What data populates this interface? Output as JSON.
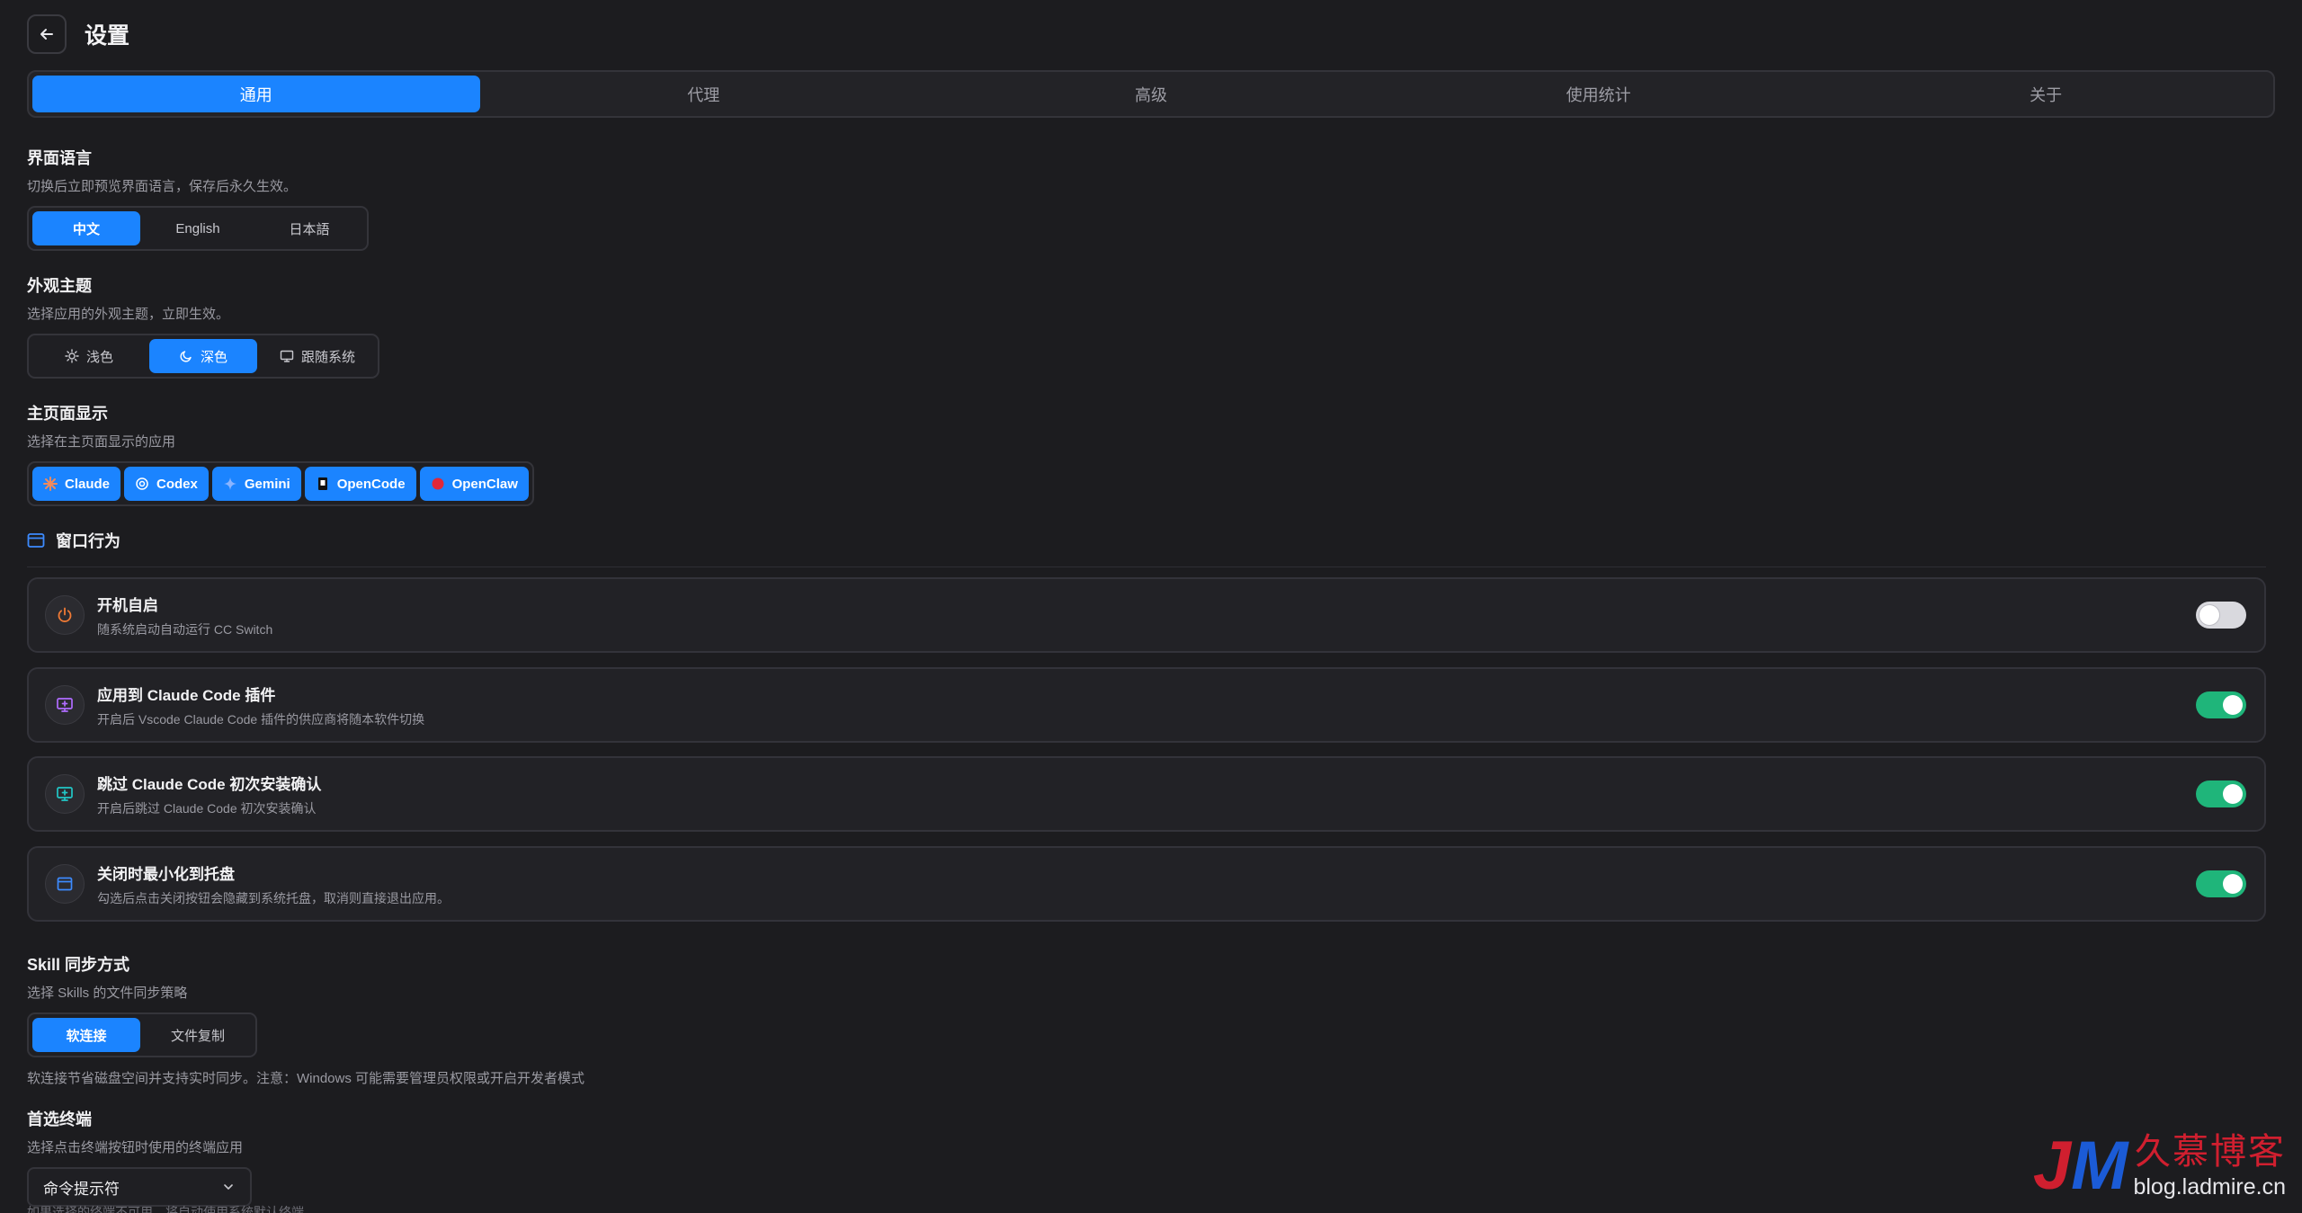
{
  "header": {
    "title": "设置"
  },
  "tabs": [
    {
      "label": "通用",
      "active": true
    },
    {
      "label": "代理",
      "active": false
    },
    {
      "label": "高级",
      "active": false
    },
    {
      "label": "使用统计",
      "active": false
    },
    {
      "label": "关于",
      "active": false
    }
  ],
  "language": {
    "title": "界面语言",
    "desc": "切换后立即预览界面语言，保存后永久生效。",
    "options": [
      "中文",
      "English",
      "日本語"
    ],
    "selected": "中文"
  },
  "theme": {
    "title": "外观主题",
    "desc": "选择应用的外观主题，立即生效。",
    "options": [
      {
        "label": "浅色",
        "icon": "sun-icon"
      },
      {
        "label": "深色",
        "icon": "moon-icon"
      },
      {
        "label": "跟随系统",
        "icon": "monitor-icon"
      }
    ],
    "selected": "深色"
  },
  "home_display": {
    "title": "主页面显示",
    "desc": "选择在主页面显示的应用",
    "apps": [
      {
        "label": "Claude",
        "icon": "claude-icon"
      },
      {
        "label": "Codex",
        "icon": "codex-icon"
      },
      {
        "label": "Gemini",
        "icon": "gemini-icon"
      },
      {
        "label": "OpenCode",
        "icon": "opencode-icon"
      },
      {
        "label": "OpenClaw",
        "icon": "openclaw-icon"
      }
    ]
  },
  "window_behavior": {
    "title": "窗口行为",
    "items": [
      {
        "title": "开机自启",
        "desc": "随系统启动自动运行 CC Switch",
        "enabled": false,
        "icon": "power-icon"
      },
      {
        "title": "应用到 Claude Code 插件",
        "desc": "开启后 Vscode Claude Code 插件的供应商将随本软件切换",
        "enabled": true,
        "icon": "monitor-plug-icon"
      },
      {
        "title": "跳过 Claude Code 初次安装确认",
        "desc": "开启后跳过 Claude Code 初次安装确认",
        "enabled": true,
        "icon": "monitor-skip-icon"
      },
      {
        "title": "关闭时最小化到托盘",
        "desc": "勾选后点击关闭按钮会隐藏到系统托盘，取消则直接退出应用。",
        "enabled": true,
        "icon": "window-icon"
      }
    ]
  },
  "skill_sync": {
    "title": "Skill 同步方式",
    "desc": "选择 Skills 的文件同步策略",
    "options": [
      "软连接",
      "文件复制"
    ],
    "selected": "软连接",
    "note": "软连接节省磁盘空间并支持实时同步。注意：Windows 可能需要管理员权限或开启开发者模式"
  },
  "terminal": {
    "title": "首选终端",
    "desc": "选择点击终端按钮时使用的终端应用",
    "value": "命令提示符",
    "cutoff_note": "如果选择的终端不可用，将自动使用系统默认终端"
  },
  "watermark": {
    "logo": "JM",
    "cn": "久慕博客",
    "url": "blog.ladmire.cn"
  },
  "colors": {
    "accent": "#1b84ff",
    "toggle_on": "#1fb57a",
    "background": "#1c1c1f"
  }
}
